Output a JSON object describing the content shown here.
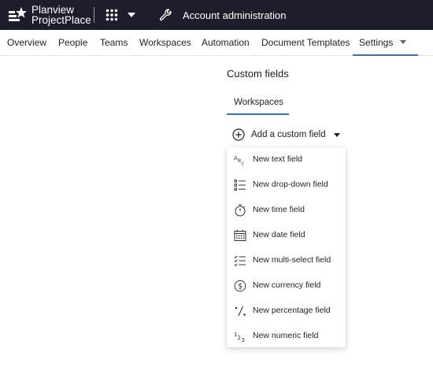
{
  "brand": {
    "line1": "Planview",
    "line2": "ProjectPlace"
  },
  "topbar": {
    "account_label": "Account administration"
  },
  "nav": {
    "tabs": [
      {
        "label": "Overview"
      },
      {
        "label": "People"
      },
      {
        "label": "Teams"
      },
      {
        "label": "Workspaces"
      },
      {
        "label": "Automation"
      },
      {
        "label": "Document Templates"
      },
      {
        "label": "Settings",
        "active": true
      }
    ]
  },
  "content": {
    "title": "Custom fields",
    "sub_tab": "Workspaces",
    "add_button": "Add a custom field"
  },
  "menu": {
    "items": [
      {
        "label": "New text field",
        "icon": "text-field-icon"
      },
      {
        "label": "New drop-down field",
        "icon": "list-icon"
      },
      {
        "label": "New time field",
        "icon": "stopwatch-icon"
      },
      {
        "label": "New date field",
        "icon": "calendar-icon"
      },
      {
        "label": "New multi-select field",
        "icon": "checklist-icon"
      },
      {
        "label": "New currency field",
        "icon": "dollar-icon"
      },
      {
        "label": "New percentage field",
        "icon": "percent-icon"
      },
      {
        "label": "New numeric field",
        "icon": "numeric-icon"
      }
    ]
  },
  "colors": {
    "topbar": "#1d1d2b",
    "accent": "#3f6fb8"
  }
}
